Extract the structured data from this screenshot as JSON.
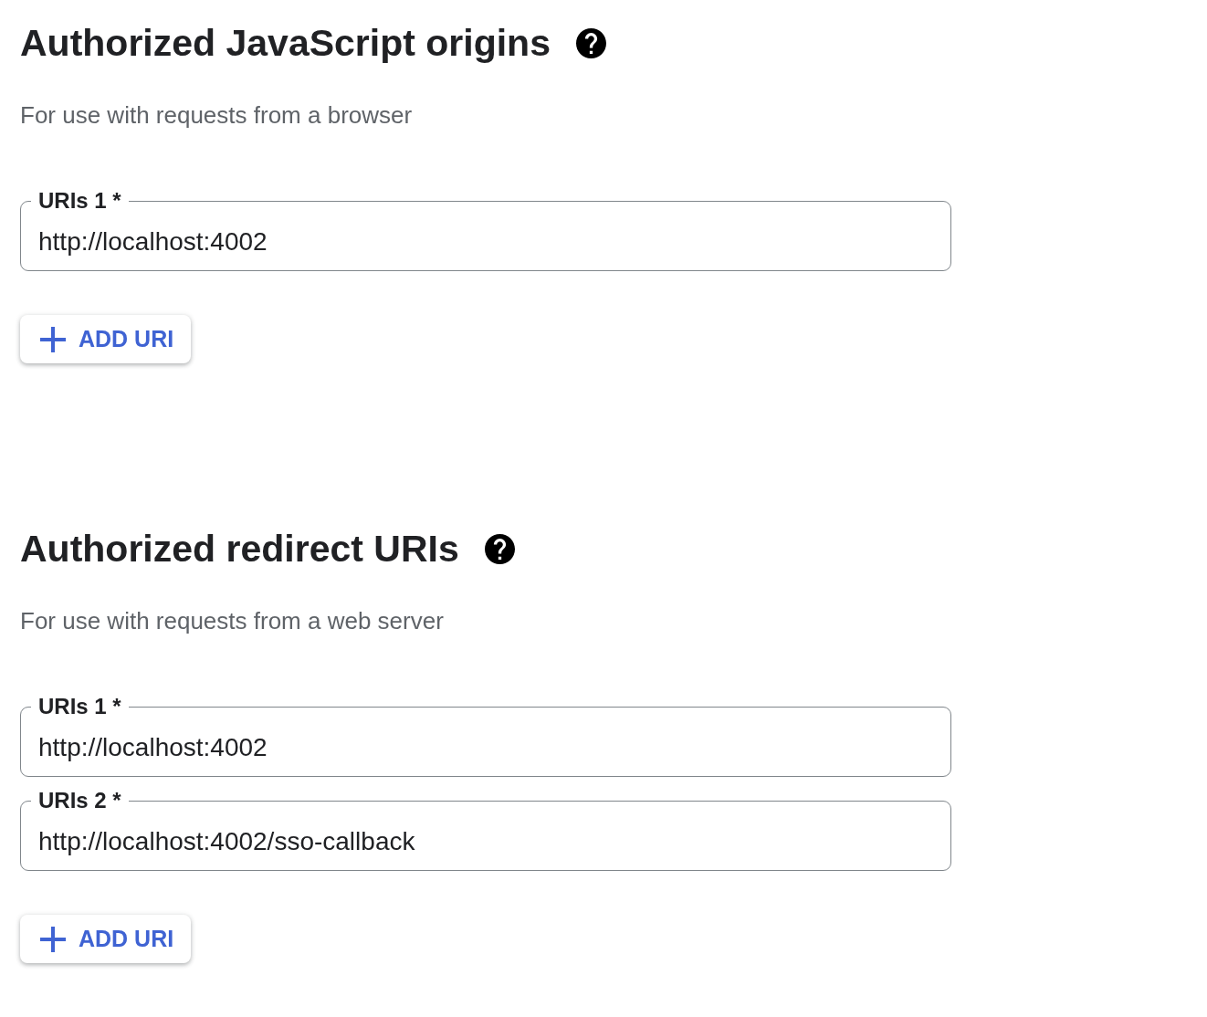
{
  "sections": [
    {
      "title": "Authorized JavaScript origins",
      "description": "For use with requests from a browser",
      "fields": [
        {
          "label": "URIs 1 *",
          "value": "http://localhost:4002"
        }
      ],
      "add_button": {
        "label": "ADD URI"
      }
    },
    {
      "title": "Authorized redirect URIs",
      "description": "For use with requests from a web server",
      "fields": [
        {
          "label": "URIs 1 *",
          "value": "http://localhost:4002"
        },
        {
          "label": "URIs 2 *",
          "value": "http://localhost:4002/sso-callback"
        }
      ],
      "add_button": {
        "label": "ADD URI"
      }
    }
  ]
}
